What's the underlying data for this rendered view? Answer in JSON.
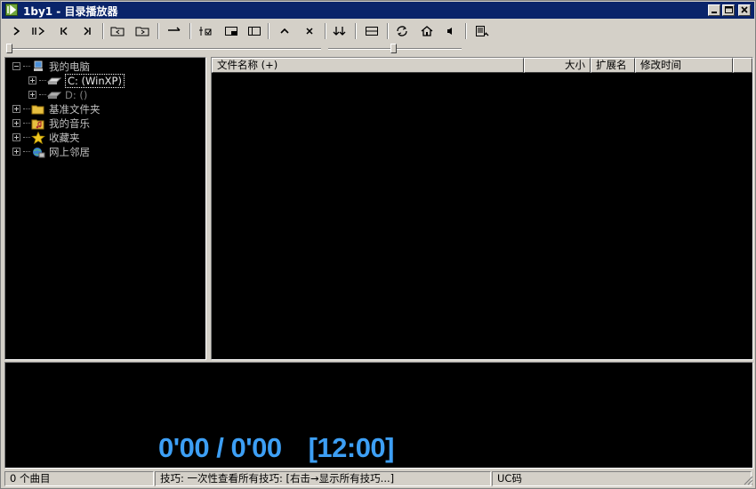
{
  "window": {
    "title": "1by1 - 目录播放器",
    "controls": [
      "minimize-icon",
      "maximize-icon",
      "close-icon"
    ]
  },
  "toolbar": {
    "buttons": [
      "play-icon",
      "pause-icon",
      "previous-icon",
      "next-icon",
      "folder-back-icon",
      "folder-forward-icon",
      "arrow-right-icon",
      "equalizer-icon",
      "mini-mode-icon",
      "panel-toggle-icon",
      "chevron-up-icon",
      "close-x-icon",
      "sort-down-icon",
      "layout-icon",
      "refresh-icon",
      "home-icon",
      "volume-icon",
      "settings-icon"
    ]
  },
  "tree": {
    "items": [
      {
        "label": "我的电脑",
        "icon": "computer-icon"
      },
      {
        "label": "C: (WinXP)",
        "icon": "drive-icon",
        "selected": true
      },
      {
        "label": "D: ()",
        "icon": "drive-icon"
      },
      {
        "label": "基准文件夹",
        "icon": "folder-icon"
      },
      {
        "label": "我的音乐",
        "icon": "music-folder-icon"
      },
      {
        "label": "收藏夹",
        "icon": "star-icon"
      },
      {
        "label": "网上邻居",
        "icon": "network-icon"
      }
    ]
  },
  "file_list": {
    "columns": [
      "文件名称 (+)",
      "大小",
      "扩展名",
      "修改时间"
    ],
    "rows": []
  },
  "player": {
    "position": "0'00",
    "separator": "/",
    "duration": "0'00",
    "clock": "[12:00]",
    "time_color": "#3d9ff5"
  },
  "status": {
    "track_count": "0 个曲目",
    "tip": "技巧: 一次性查看所有技巧: [右击→显示所有技巧...]",
    "encoding": "UC码"
  }
}
